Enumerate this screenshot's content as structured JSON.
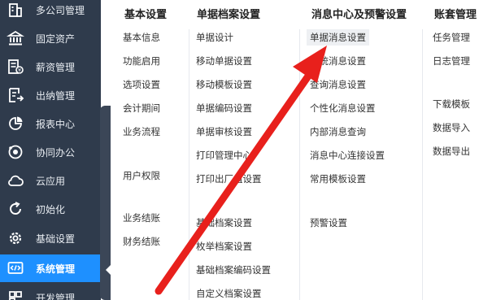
{
  "sidebar": {
    "items": [
      {
        "label": "多公司管理",
        "icon": "building-icon"
      },
      {
        "label": "固定资产",
        "icon": "bank-icon"
      },
      {
        "label": "薪资管理",
        "icon": "payroll-icon"
      },
      {
        "label": "出纳管理",
        "icon": "cashier-icon"
      },
      {
        "label": "报表中心",
        "icon": "pie-chart-icon"
      },
      {
        "label": "协同办公",
        "icon": "collaboration-icon"
      },
      {
        "label": "云应用",
        "icon": "cloud-icon"
      },
      {
        "label": "初始化",
        "icon": "refresh-icon"
      },
      {
        "label": "基础设置",
        "icon": "gear-icon"
      },
      {
        "label": "系统管理",
        "icon": "code-icon"
      },
      {
        "label": "开发管理",
        "icon": "dev-icon"
      }
    ],
    "active": "系统管理"
  },
  "columns": {
    "basic": {
      "title": "基本设置",
      "items": [
        "基本信息",
        "功能启用",
        "选项设置",
        "会计期间",
        "业务流程",
        "用户权限",
        "业务结账",
        "财务结账"
      ]
    },
    "docs": {
      "title": "单据档案设置",
      "items": [
        "单据设计",
        "移动单据设置",
        "移动模板设置",
        "单据编码设置",
        "单据审核设置",
        "打印管理中心",
        "打印出厂值设置",
        "基础档案设置",
        "枚举档案设置",
        "基础档案编码设置",
        "自定义档案设置"
      ]
    },
    "messages": {
      "title": "消息中心及预警设置",
      "items": [
        "单据消息设置",
        "系统消息设置",
        "查询消息设置",
        "个性化消息设置",
        "内部消息查询",
        "消息中心连接设置",
        "常用模板设置",
        "预警设置"
      ]
    },
    "accounts": {
      "title": "账套管理",
      "items": [
        "任务管理",
        "日志管理",
        "下载模板",
        "数据导入",
        "数据导出"
      ]
    }
  },
  "colors": {
    "sidebar_bg": "#2f3b4c",
    "active_bg": "#1e90ff",
    "arrow": "#e8201c"
  }
}
